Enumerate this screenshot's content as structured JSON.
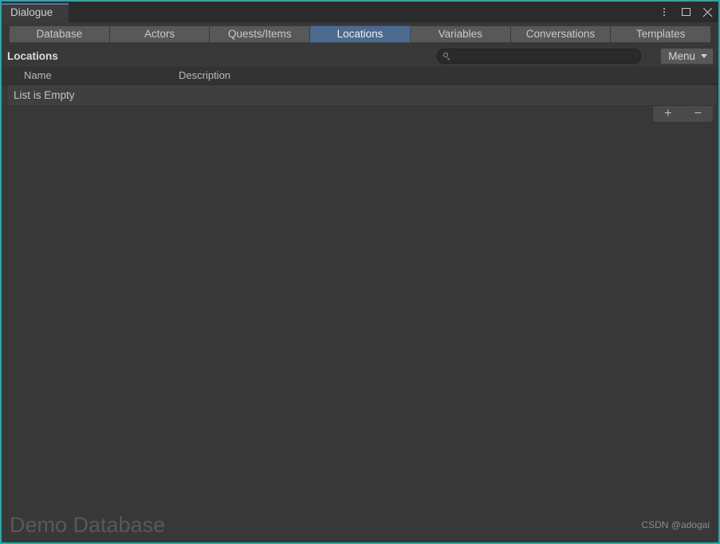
{
  "window": {
    "document_tab_label": "Dialogue",
    "accent_border_color": "#2aa8a8",
    "controls": {
      "kebab_label": "kebab-menu",
      "maximize_label": "maximize",
      "close_label": "close"
    }
  },
  "tabs": [
    {
      "label": "Database",
      "selected": false
    },
    {
      "label": "Actors",
      "selected": false
    },
    {
      "label": "Quests/Items",
      "selected": false
    },
    {
      "label": "Locations",
      "selected": true
    },
    {
      "label": "Variables",
      "selected": false
    },
    {
      "label": "Conversations",
      "selected": false
    },
    {
      "label": "Templates",
      "selected": false
    }
  ],
  "toolbar": {
    "panel_title": "Locations",
    "search": {
      "value": "",
      "placeholder": ""
    },
    "menu_label": "Menu",
    "selected_tab_color": "#4b6a8e"
  },
  "list": {
    "columns": [
      {
        "label": "Name"
      },
      {
        "label": "Description"
      }
    ],
    "rows": [],
    "empty_message": "List is Empty",
    "add_label": "+",
    "remove_label": "−"
  },
  "footer": {
    "database_name": "Demo Database",
    "watermark": "CSDN @adogai"
  }
}
